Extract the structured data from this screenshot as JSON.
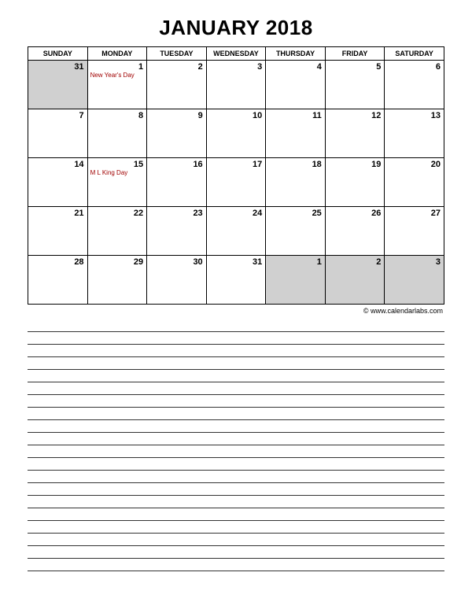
{
  "title": "JANUARY 2018",
  "weekdays": [
    "SUNDAY",
    "MONDAY",
    "TUESDAY",
    "WEDNESDAY",
    "THURSDAY",
    "FRIDAY",
    "SATURDAY"
  ],
  "rows": [
    [
      {
        "n": "31",
        "grey": true,
        "event": ""
      },
      {
        "n": "1",
        "grey": false,
        "event": "New Year's Day"
      },
      {
        "n": "2",
        "grey": false,
        "event": ""
      },
      {
        "n": "3",
        "grey": false,
        "event": ""
      },
      {
        "n": "4",
        "grey": false,
        "event": ""
      },
      {
        "n": "5",
        "grey": false,
        "event": ""
      },
      {
        "n": "6",
        "grey": false,
        "event": ""
      }
    ],
    [
      {
        "n": "7",
        "grey": false,
        "event": ""
      },
      {
        "n": "8",
        "grey": false,
        "event": ""
      },
      {
        "n": "9",
        "grey": false,
        "event": ""
      },
      {
        "n": "10",
        "grey": false,
        "event": ""
      },
      {
        "n": "11",
        "grey": false,
        "event": ""
      },
      {
        "n": "12",
        "grey": false,
        "event": ""
      },
      {
        "n": "13",
        "grey": false,
        "event": ""
      }
    ],
    [
      {
        "n": "14",
        "grey": false,
        "event": ""
      },
      {
        "n": "15",
        "grey": false,
        "event": "M L King Day"
      },
      {
        "n": "16",
        "grey": false,
        "event": ""
      },
      {
        "n": "17",
        "grey": false,
        "event": ""
      },
      {
        "n": "18",
        "grey": false,
        "event": ""
      },
      {
        "n": "19",
        "grey": false,
        "event": ""
      },
      {
        "n": "20",
        "grey": false,
        "event": ""
      }
    ],
    [
      {
        "n": "21",
        "grey": false,
        "event": ""
      },
      {
        "n": "22",
        "grey": false,
        "event": ""
      },
      {
        "n": "23",
        "grey": false,
        "event": ""
      },
      {
        "n": "24",
        "grey": false,
        "event": ""
      },
      {
        "n": "25",
        "grey": false,
        "event": ""
      },
      {
        "n": "26",
        "grey": false,
        "event": ""
      },
      {
        "n": "27",
        "grey": false,
        "event": ""
      }
    ],
    [
      {
        "n": "28",
        "grey": false,
        "event": ""
      },
      {
        "n": "29",
        "grey": false,
        "event": ""
      },
      {
        "n": "30",
        "grey": false,
        "event": ""
      },
      {
        "n": "31",
        "grey": false,
        "event": ""
      },
      {
        "n": "1",
        "grey": true,
        "event": ""
      },
      {
        "n": "2",
        "grey": true,
        "event": ""
      },
      {
        "n": "3",
        "grey": true,
        "event": ""
      }
    ]
  ],
  "credit": "© www.calendarlabs.com",
  "note_lines": 20
}
